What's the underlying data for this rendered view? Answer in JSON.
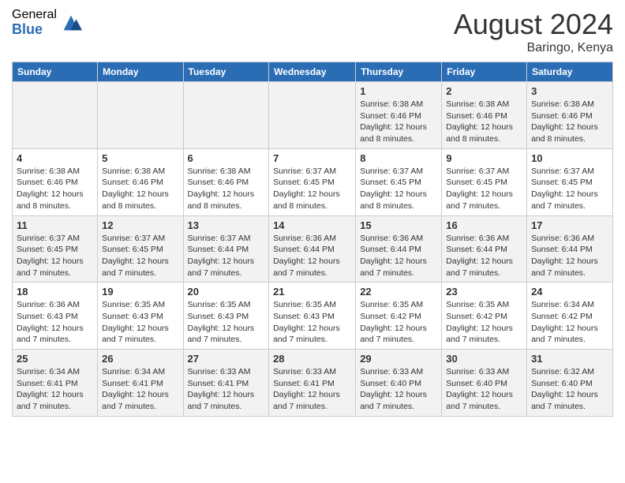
{
  "logo": {
    "general": "General",
    "blue": "Blue"
  },
  "title": {
    "month_year": "August 2024",
    "location": "Baringo, Kenya"
  },
  "calendar": {
    "headers": [
      "Sunday",
      "Monday",
      "Tuesday",
      "Wednesday",
      "Thursday",
      "Friday",
      "Saturday"
    ],
    "weeks": [
      [
        {
          "day": "",
          "info": ""
        },
        {
          "day": "",
          "info": ""
        },
        {
          "day": "",
          "info": ""
        },
        {
          "day": "",
          "info": ""
        },
        {
          "day": "1",
          "info": "Sunrise: 6:38 AM\nSunset: 6:46 PM\nDaylight: 12 hours and 8 minutes."
        },
        {
          "day": "2",
          "info": "Sunrise: 6:38 AM\nSunset: 6:46 PM\nDaylight: 12 hours and 8 minutes."
        },
        {
          "day": "3",
          "info": "Sunrise: 6:38 AM\nSunset: 6:46 PM\nDaylight: 12 hours and 8 minutes."
        }
      ],
      [
        {
          "day": "4",
          "info": "Sunrise: 6:38 AM\nSunset: 6:46 PM\nDaylight: 12 hours and 8 minutes."
        },
        {
          "day": "5",
          "info": "Sunrise: 6:38 AM\nSunset: 6:46 PM\nDaylight: 12 hours and 8 minutes."
        },
        {
          "day": "6",
          "info": "Sunrise: 6:38 AM\nSunset: 6:46 PM\nDaylight: 12 hours and 8 minutes."
        },
        {
          "day": "7",
          "info": "Sunrise: 6:37 AM\nSunset: 6:45 PM\nDaylight: 12 hours and 8 minutes."
        },
        {
          "day": "8",
          "info": "Sunrise: 6:37 AM\nSunset: 6:45 PM\nDaylight: 12 hours and 8 minutes."
        },
        {
          "day": "9",
          "info": "Sunrise: 6:37 AM\nSunset: 6:45 PM\nDaylight: 12 hours and 7 minutes."
        },
        {
          "day": "10",
          "info": "Sunrise: 6:37 AM\nSunset: 6:45 PM\nDaylight: 12 hours and 7 minutes."
        }
      ],
      [
        {
          "day": "11",
          "info": "Sunrise: 6:37 AM\nSunset: 6:45 PM\nDaylight: 12 hours and 7 minutes."
        },
        {
          "day": "12",
          "info": "Sunrise: 6:37 AM\nSunset: 6:45 PM\nDaylight: 12 hours and 7 minutes."
        },
        {
          "day": "13",
          "info": "Sunrise: 6:37 AM\nSunset: 6:44 PM\nDaylight: 12 hours and 7 minutes."
        },
        {
          "day": "14",
          "info": "Sunrise: 6:36 AM\nSunset: 6:44 PM\nDaylight: 12 hours and 7 minutes."
        },
        {
          "day": "15",
          "info": "Sunrise: 6:36 AM\nSunset: 6:44 PM\nDaylight: 12 hours and 7 minutes."
        },
        {
          "day": "16",
          "info": "Sunrise: 6:36 AM\nSunset: 6:44 PM\nDaylight: 12 hours and 7 minutes."
        },
        {
          "day": "17",
          "info": "Sunrise: 6:36 AM\nSunset: 6:44 PM\nDaylight: 12 hours and 7 minutes."
        }
      ],
      [
        {
          "day": "18",
          "info": "Sunrise: 6:36 AM\nSunset: 6:43 PM\nDaylight: 12 hours and 7 minutes."
        },
        {
          "day": "19",
          "info": "Sunrise: 6:35 AM\nSunset: 6:43 PM\nDaylight: 12 hours and 7 minutes."
        },
        {
          "day": "20",
          "info": "Sunrise: 6:35 AM\nSunset: 6:43 PM\nDaylight: 12 hours and 7 minutes."
        },
        {
          "day": "21",
          "info": "Sunrise: 6:35 AM\nSunset: 6:43 PM\nDaylight: 12 hours and 7 minutes."
        },
        {
          "day": "22",
          "info": "Sunrise: 6:35 AM\nSunset: 6:42 PM\nDaylight: 12 hours and 7 minutes."
        },
        {
          "day": "23",
          "info": "Sunrise: 6:35 AM\nSunset: 6:42 PM\nDaylight: 12 hours and 7 minutes."
        },
        {
          "day": "24",
          "info": "Sunrise: 6:34 AM\nSunset: 6:42 PM\nDaylight: 12 hours and 7 minutes."
        }
      ],
      [
        {
          "day": "25",
          "info": "Sunrise: 6:34 AM\nSunset: 6:41 PM\nDaylight: 12 hours and 7 minutes."
        },
        {
          "day": "26",
          "info": "Sunrise: 6:34 AM\nSunset: 6:41 PM\nDaylight: 12 hours and 7 minutes."
        },
        {
          "day": "27",
          "info": "Sunrise: 6:33 AM\nSunset: 6:41 PM\nDaylight: 12 hours and 7 minutes."
        },
        {
          "day": "28",
          "info": "Sunrise: 6:33 AM\nSunset: 6:41 PM\nDaylight: 12 hours and 7 minutes."
        },
        {
          "day": "29",
          "info": "Sunrise: 6:33 AM\nSunset: 6:40 PM\nDaylight: 12 hours and 7 minutes."
        },
        {
          "day": "30",
          "info": "Sunrise: 6:33 AM\nSunset: 6:40 PM\nDaylight: 12 hours and 7 minutes."
        },
        {
          "day": "31",
          "info": "Sunrise: 6:32 AM\nSunset: 6:40 PM\nDaylight: 12 hours and 7 minutes."
        }
      ]
    ]
  }
}
